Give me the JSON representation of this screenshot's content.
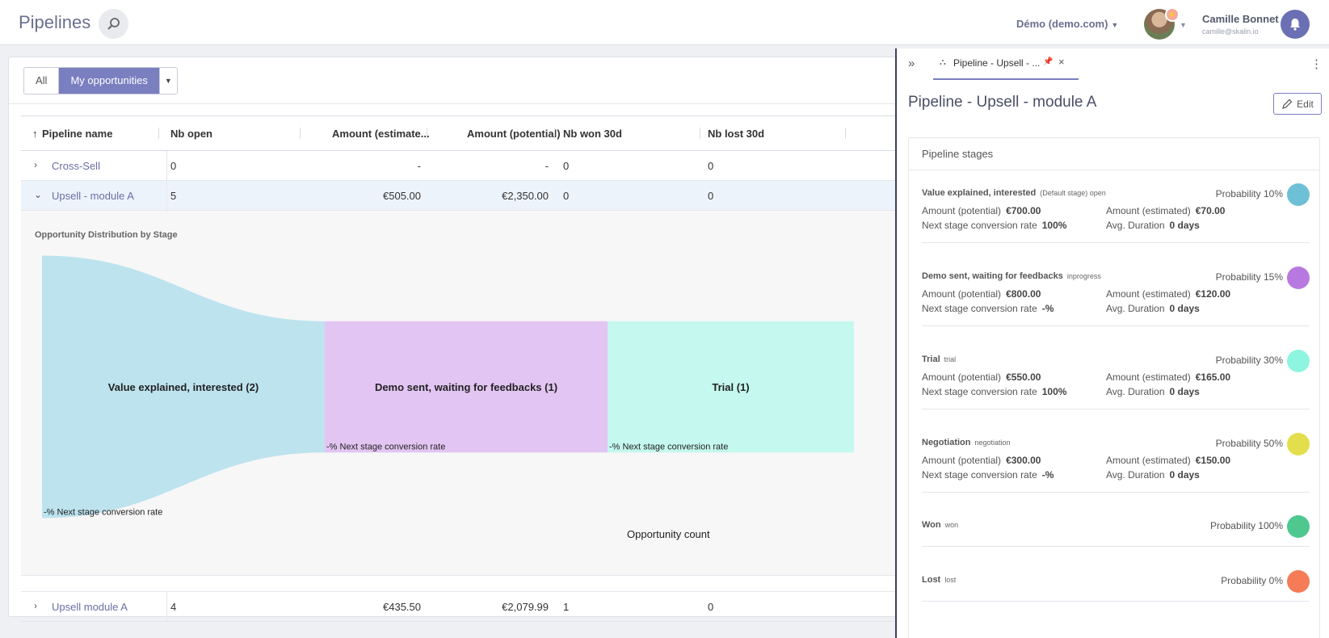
{
  "header": {
    "title": "Pipelines",
    "workspace": "Démo (demo.com)",
    "user_name": "Camille Bonnet",
    "user_email": "camille@skalin.io"
  },
  "filters": {
    "all_label": "All",
    "mine_label": "My opportunities"
  },
  "table": {
    "columns": [
      "Pipeline name",
      "Nb open",
      "Amount (estimate...",
      "Amount (potential)",
      "Nb won 30d",
      "Nb lost 30d"
    ],
    "rows": [
      {
        "name": "Cross-Sell",
        "nb_open": "0",
        "amount_estimated": "-",
        "amount_potential": "-",
        "nb_won": "0",
        "nb_lost": "0"
      },
      {
        "name": "Upsell - module A",
        "nb_open": "5",
        "amount_estimated": "€505.00",
        "amount_potential": "€2,350.00",
        "nb_won": "0",
        "nb_lost": "0"
      },
      {
        "name": "Upsell module A",
        "nb_open": "4",
        "amount_estimated": "€435.50",
        "amount_potential": "€2,079.99",
        "nb_won": "1",
        "nb_lost": "0"
      }
    ]
  },
  "chart_data": {
    "type": "area",
    "title": "Opportunity Distribution by Stage",
    "xlabel": "Opportunity count",
    "categories": [
      "Value explained, interested (2)",
      "Demo sent, waiting for feedbacks (1)",
      "Trial (1)"
    ],
    "values": [
      2,
      1,
      1
    ],
    "conversion_labels": [
      "-% Next stage conversion rate",
      "-% Next stage conversion rate",
      "-% Next stage conversion rate"
    ],
    "colors": [
      "#bde3ee",
      "#e2c5f2",
      "#c5f8ee"
    ]
  },
  "side_panel": {
    "tab_label": "Pipeline - Upsell - ...",
    "title": "Pipeline - Upsell - module A",
    "edit_label": "Edit",
    "card_title": "Pipeline stages",
    "labels": {
      "amount_potential": "Amount (potential)",
      "amount_estimated": "Amount (estimated)",
      "next_rate": "Next stage conversion rate",
      "avg_duration": "Avg. Duration"
    },
    "stages": [
      {
        "name": "Value explained, interested",
        "type": "(Default stage) open",
        "probability": "Probability 10%",
        "color": "#6ec0d6",
        "potential": "€700.00",
        "estimated": "€70.00",
        "rate": "100%",
        "duration": "0 days"
      },
      {
        "name": "Demo sent, waiting for feedbacks",
        "type": "inprogress",
        "probability": "Probability 15%",
        "color": "#b779e0",
        "potential": "€800.00",
        "estimated": "€120.00",
        "rate": "-%",
        "duration": "0 days"
      },
      {
        "name": "Trial",
        "type": "trial",
        "probability": "Probability 30%",
        "color": "#8ef5e0",
        "potential": "€550.00",
        "estimated": "€165.00",
        "rate": "100%",
        "duration": "0 days"
      },
      {
        "name": "Negotiation",
        "type": "negotiation",
        "probability": "Probability 50%",
        "color": "#e3df4c",
        "potential": "€300.00",
        "estimated": "€150.00",
        "rate": "-%",
        "duration": "0 days"
      },
      {
        "name": "Won",
        "type": "won",
        "probability": "Probability 100%",
        "color": "#4ec88e"
      },
      {
        "name": "Lost",
        "type": "lost",
        "probability": "Probability 0%",
        "color": "#f57c57"
      }
    ]
  }
}
